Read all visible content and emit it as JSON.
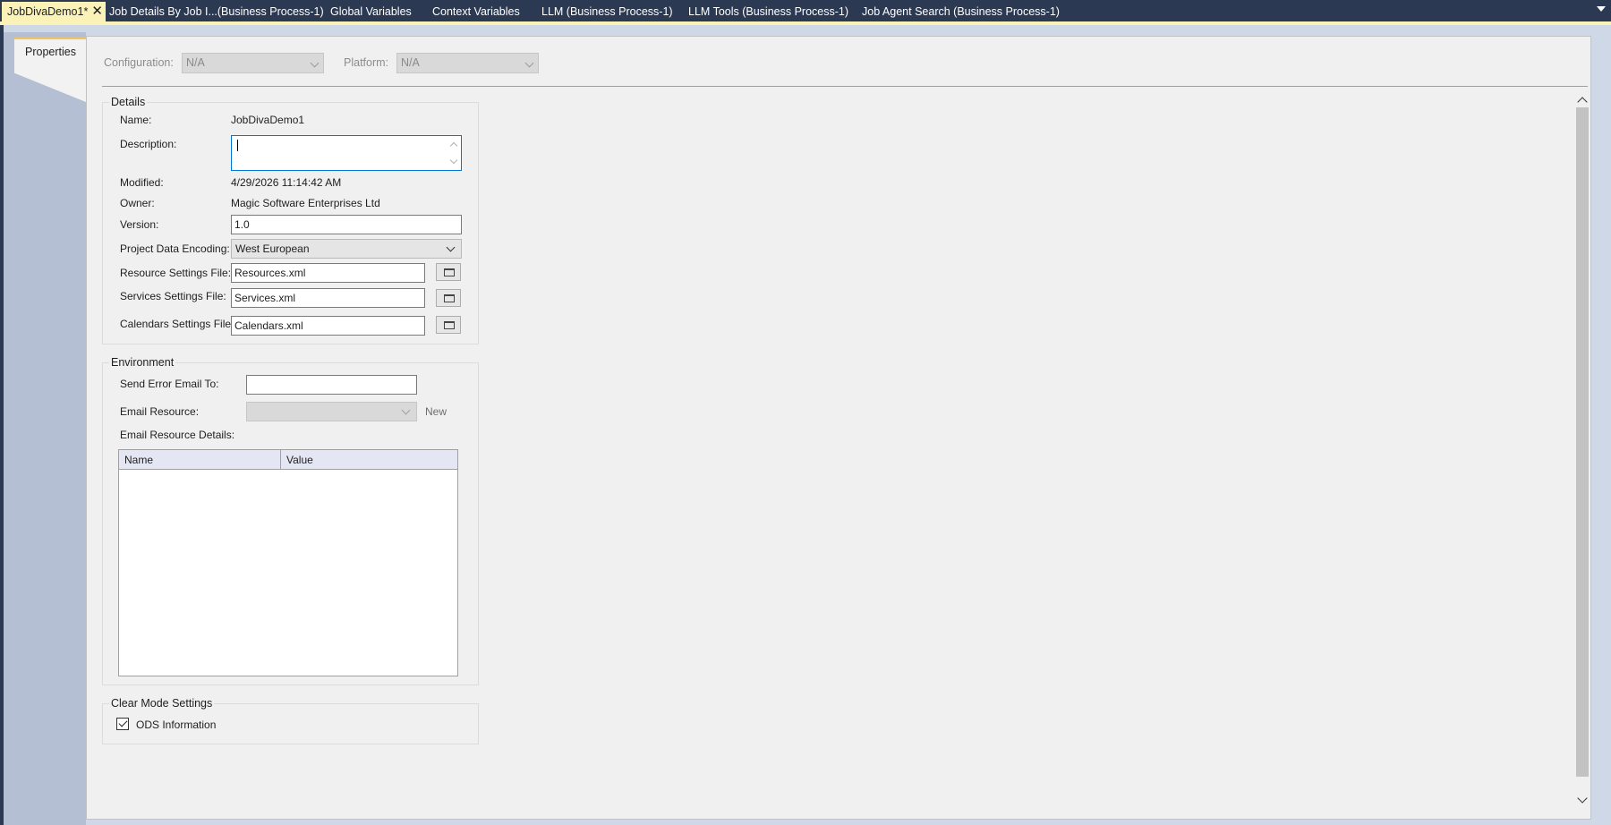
{
  "document_tabs": [
    {
      "label": "JobDivaDemo1*",
      "active": true
    },
    {
      "label": "Job Details By Job I...(Business Process-1)"
    },
    {
      "label": "Global Variables"
    },
    {
      "label": "Context Variables"
    },
    {
      "label": "LLM (Business Process-1)"
    },
    {
      "label": "LLM Tools (Business Process-1)"
    },
    {
      "label": "Job Agent Search (Business Process-1)"
    }
  ],
  "side_tab": {
    "label": "Properties"
  },
  "config_bar": {
    "configuration_label": "Configuration:",
    "configuration_value": "N/A",
    "platform_label": "Platform:",
    "platform_value": "N/A"
  },
  "details": {
    "title": "Details",
    "name_label": "Name:",
    "name_value": "JobDivaDemo1",
    "description_label": "Description:",
    "description_value": "",
    "modified_label": "Modified:",
    "modified_value": "4/29/2026 11:14:42 AM",
    "owner_label": "Owner:",
    "owner_value": "Magic Software Enterprises Ltd",
    "version_label": "Version:",
    "version_value": "1.0",
    "encoding_label": "Project Data Encoding:",
    "encoding_value": "West European",
    "resource_file_label": "Resource Settings File:",
    "resource_file_value": "Resources.xml",
    "services_file_label": "Services Settings File:",
    "services_file_value": "Services.xml",
    "calendars_file_label": "Calendars Settings File:",
    "calendars_file_value": "Calendars.xml"
  },
  "environment": {
    "title": "Environment",
    "send_error_label": "Send Error Email To:",
    "send_error_value": "",
    "email_resource_label": "Email Resource:",
    "email_resource_value": "",
    "new_link": "New",
    "email_details_label": "Email Resource Details:",
    "grid_columns": [
      "Name",
      "Value"
    ],
    "grid_rows": []
  },
  "clear_mode": {
    "title": "Clear Mode Settings",
    "ods_label": "ODS Information",
    "ods_checked": true
  },
  "colors": {
    "tab_strip_bg": "#2b3a52",
    "active_tab_bg": "#fbf2b8",
    "content_bg": "#f0f0f0",
    "focus_border": "#0078d7"
  }
}
